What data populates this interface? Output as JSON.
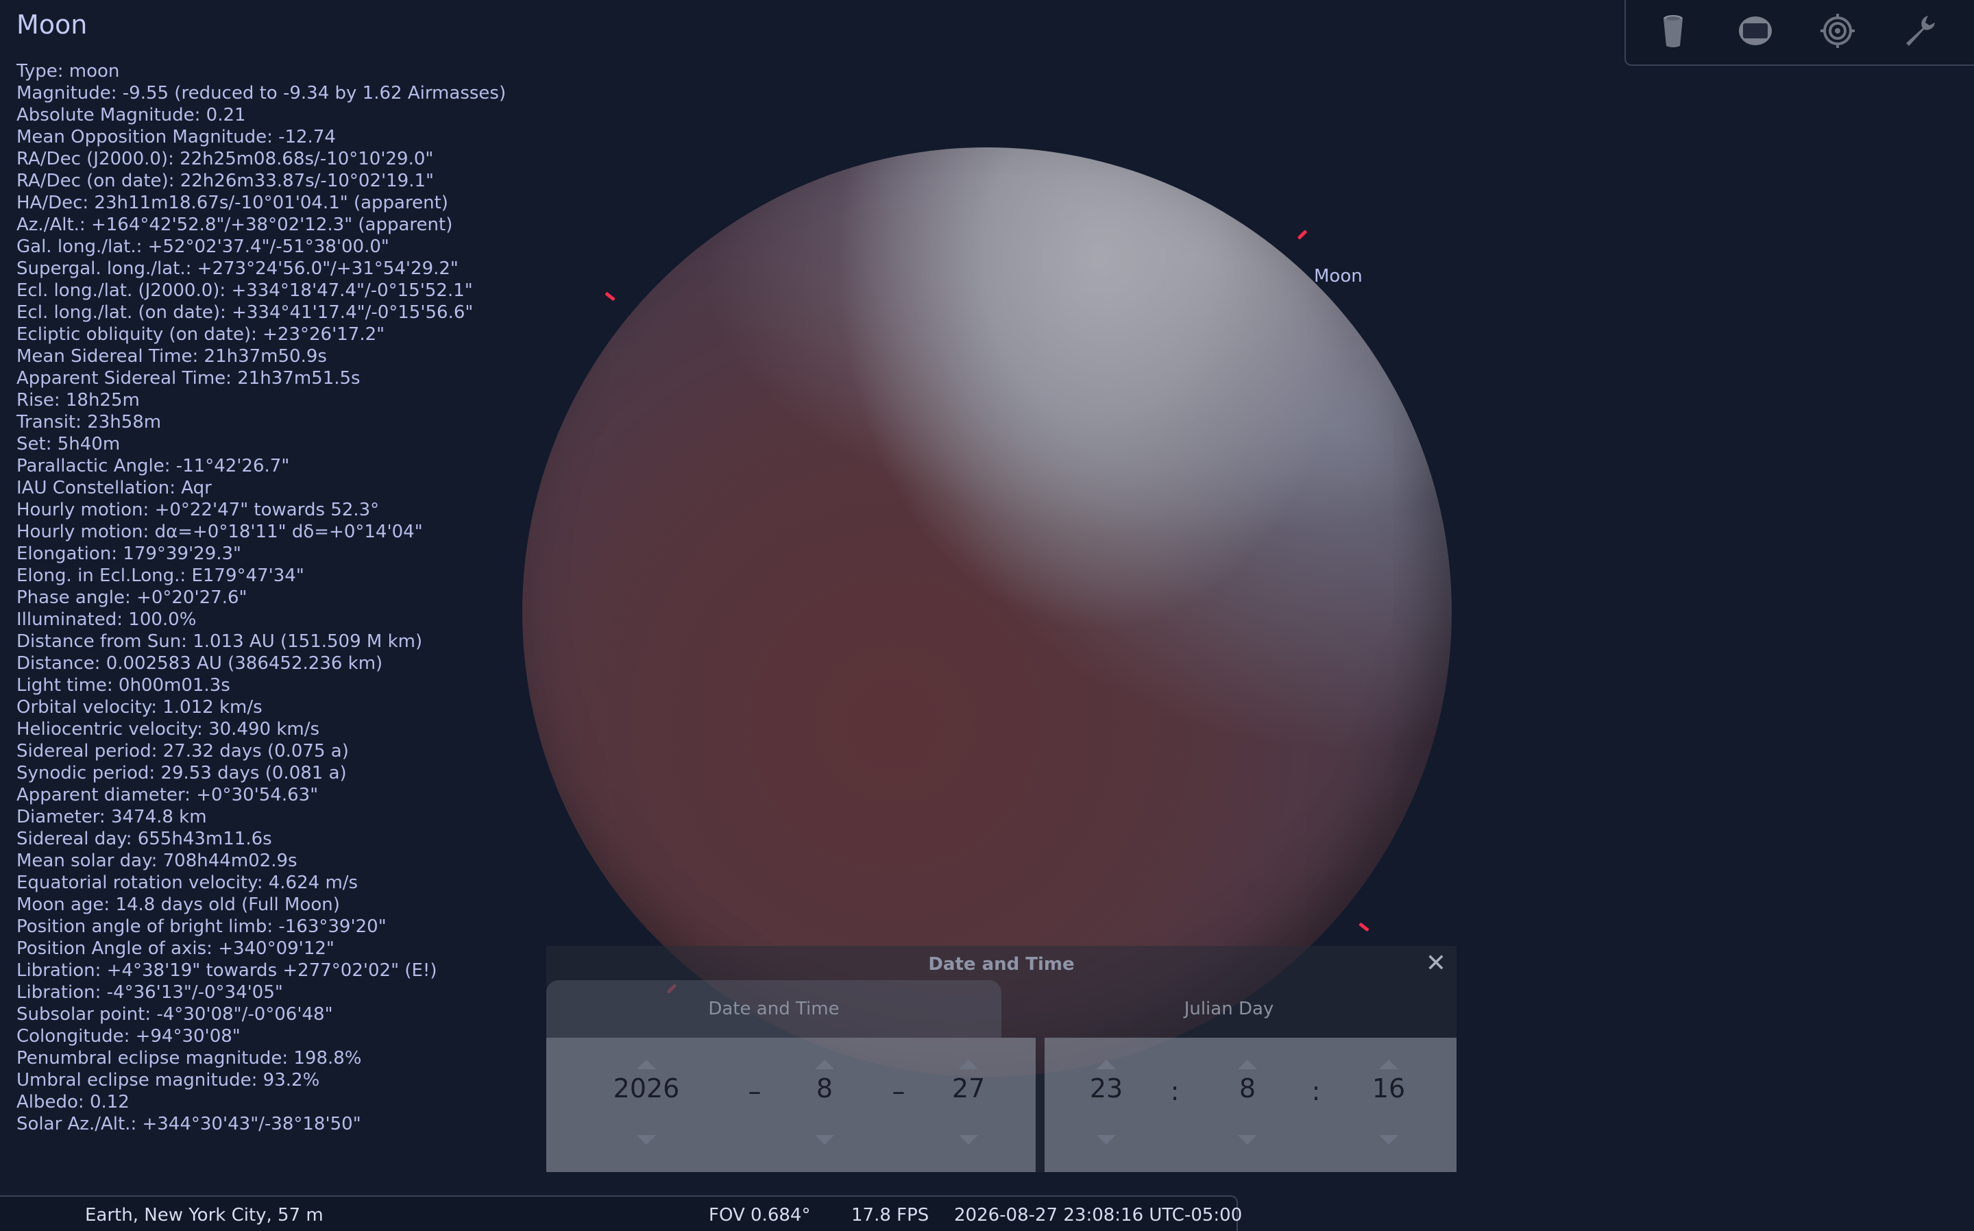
{
  "info": {
    "title": "Moon",
    "lines": [
      "Type: moon",
      "Magnitude: -9.55 (reduced to -9.34 by 1.62 Airmasses)",
      "Absolute Magnitude: 0.21",
      "Mean Opposition Magnitude: -12.74",
      "RA/Dec (J2000.0): 22h25m08.68s/-10°10'29.0\"",
      "RA/Dec (on date): 22h26m33.87s/-10°02'19.1\"",
      "HA/Dec: 23h11m18.67s/-10°01'04.1\" (apparent)",
      "Az./Alt.: +164°42'52.8\"/+38°02'12.3\" (apparent)",
      "Gal. long./lat.: +52°02'37.4\"/-51°38'00.0\"",
      "Supergal. long./lat.: +273°24'56.0\"/+31°54'29.2\"",
      "Ecl. long./lat. (J2000.0): +334°18'47.4\"/-0°15'52.1\"",
      "Ecl. long./lat. (on date): +334°41'17.4\"/-0°15'56.6\"",
      "Ecliptic obliquity (on date): +23°26'17.2\"",
      "Mean Sidereal Time: 21h37m50.9s",
      "Apparent Sidereal Time: 21h37m51.5s",
      "Rise: 18h25m",
      "Transit: 23h58m",
      "Set: 5h40m",
      "Parallactic Angle: -11°42'26.7\"",
      "IAU Constellation: Aqr",
      "Hourly motion: +0°22'47\" towards 52.3°",
      "Hourly motion: dα=+0°18'11\" dδ=+0°14'04\"",
      "Elongation: 179°39'29.3\"",
      "Elong. in Ecl.Long.: E179°47'34\"",
      "Phase angle: +0°20'27.6\"",
      "Illuminated: 100.0%",
      "Distance from Sun: 1.013 AU (151.509 M km)",
      "Distance: 0.002583 AU (386452.236 km)",
      "Light time: 0h00m01.3s",
      "Orbital velocity: 1.012 km/s",
      "Heliocentric velocity: 30.490 km/s",
      "Sidereal period: 27.32 days (0.075 a)",
      "Synodic period: 29.53 days (0.081 a)",
      "Apparent diameter: +0°30'54.63\"",
      "Diameter: 3474.8 km",
      "Sidereal day: 655h43m11.6s",
      "Mean solar day: 708h44m02.9s",
      "Equatorial rotation velocity: 4.624 m/s",
      "Moon age: 14.8 days old (Full Moon)",
      "Position angle of bright limb: -163°39'20\"",
      "Position Angle of axis: +340°09'12\"",
      "Libration: +4°38'19\" towards +277°02'02\" (E!)",
      "Libration: -4°36'13\"/-0°34'05\"",
      "Subsolar point: -4°30'08\"/-0°06'48\"",
      "Colongitude: +94°30'08\"",
      "Penumbral eclipse magnitude: 198.8%",
      "Umbral eclipse magnitude: 93.2%",
      "Albedo: 0.12",
      "Solar Az./Alt.: +344°30'43\"/-38°18'50\""
    ]
  },
  "sky": {
    "object_label": "Moon"
  },
  "toolbar": {
    "icons": [
      "bin-icon",
      "screen-icon",
      "target-icon",
      "wrench-icon"
    ]
  },
  "date_time_dialog": {
    "title": "Date and Time",
    "close_glyph": "✕",
    "tabs": [
      "Date and Time",
      "Julian Day"
    ],
    "year": "2026",
    "month": "8",
    "day": "27",
    "hour": "23",
    "minute": "8",
    "second": "16",
    "date_sep": "–",
    "time_sep": ":"
  },
  "status_bar": {
    "location": "Earth, New York City, 57 m",
    "fov": "FOV 0.684°",
    "fps": "17.8 FPS",
    "datetime": "2026-08-27 23:08:16 UTC-05:00"
  },
  "colors": {
    "background": "#121a2c",
    "text": "#b6bde8",
    "marker": "#ff2a4a"
  }
}
